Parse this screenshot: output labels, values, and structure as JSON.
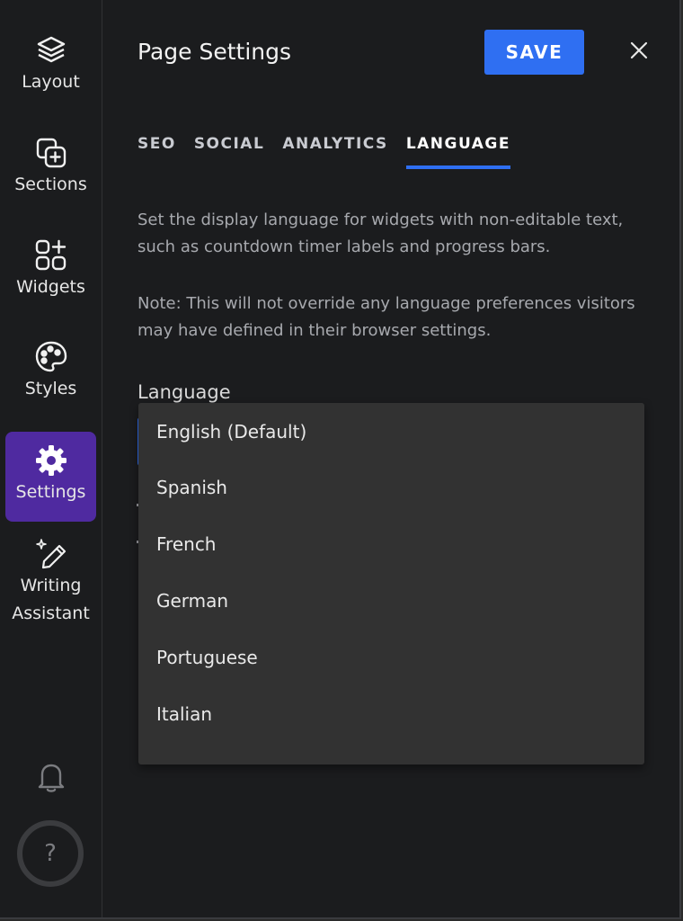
{
  "sidebar": {
    "items": [
      {
        "label": "Layout",
        "icon": "layers-icon"
      },
      {
        "label": "Sections",
        "icon": "add-section-icon"
      },
      {
        "label": "Widgets",
        "icon": "widgets-icon"
      },
      {
        "label": "Styles",
        "icon": "palette-icon"
      },
      {
        "label": "Settings",
        "icon": "gear-icon",
        "active": true
      },
      {
        "label_line1": "Writing",
        "label_line2": "Assistant",
        "icon": "sparkle-pen-icon"
      }
    ],
    "bell_icon": "bell-icon",
    "help_label": "?"
  },
  "header": {
    "title": "Page Settings",
    "save_label": "SAVE",
    "close_icon": "close-icon"
  },
  "tabs": [
    {
      "label": "SEO"
    },
    {
      "label": "SOCIAL"
    },
    {
      "label": "ANALYTICS"
    },
    {
      "label": "LANGUAGE",
      "active": true
    }
  ],
  "content": {
    "description": "Set the display language for widgets with non-editable text, such as countdown timer labels and progress bars.",
    "note": "Note: This will not override any language preferences visitors may have defined in their browser settings.",
    "language_label": "Language"
  },
  "language_dropdown": {
    "selected": "English (Default)",
    "options": [
      "English (Default)",
      "Spanish",
      "French",
      "German",
      "Portuguese",
      "Italian"
    ]
  },
  "colors": {
    "accent": "#2f6ff2",
    "active_nav": "#4f2aa0",
    "background": "#1b1c1e",
    "dropdown_bg": "#323232"
  }
}
